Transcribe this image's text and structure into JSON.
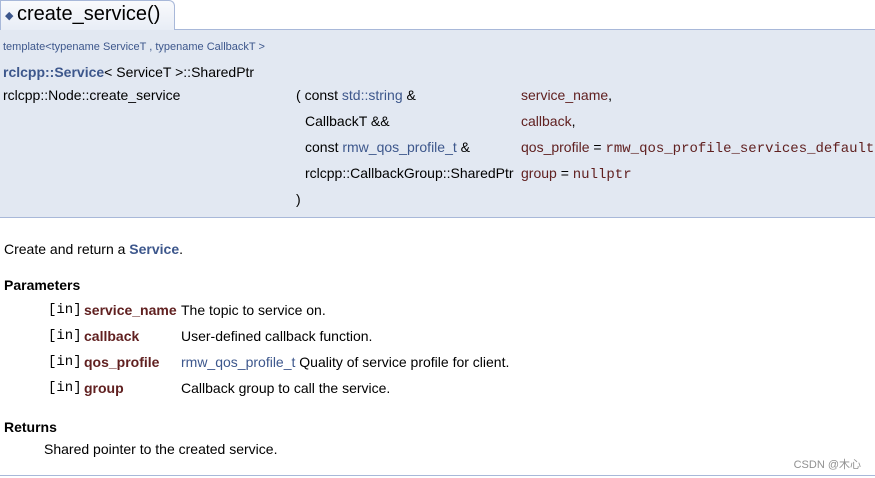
{
  "header": {
    "function_title": "create_service()"
  },
  "proto": {
    "template_line": "template<typename ServiceT , typename CallbackT >",
    "return_link": "rclcpp::Service",
    "return_rest": "< ServiceT >::SharedPtr",
    "function_name": "rclcpp::Node::create_service",
    "open_paren": "(",
    "close_paren": ")",
    "params": [
      {
        "prefix": "const ",
        "type_link": "std::string",
        "suffix": " &",
        "name": "service_name",
        "tail": ",",
        "default": ""
      },
      {
        "prefix": "CallbackT &&",
        "type_link": "",
        "suffix": "",
        "name": "callback",
        "tail": ",",
        "default": ""
      },
      {
        "prefix": "const ",
        "type_link": "rmw_qos_profile_t",
        "suffix": " &",
        "name": "qos_profile",
        "tail": " = ",
        "default": "rmw_qos_profile_services_default"
      },
      {
        "prefix": "rclcpp::CallbackGroup::SharedPtr",
        "type_link": "",
        "suffix": "",
        "name": "group",
        "tail": " = ",
        "default": "nullptr"
      }
    ]
  },
  "doc": {
    "description_prefix": "Create and return a ",
    "description_link": "Service",
    "description_suffix": ".",
    "parameters_heading": "Parameters",
    "parameters": [
      {
        "dir": "[in]",
        "name": "service_name",
        "desc_link": "",
        "desc": "The topic to service on."
      },
      {
        "dir": "[in]",
        "name": "callback",
        "desc_link": "",
        "desc": "User-defined callback function."
      },
      {
        "dir": "[in]",
        "name": "qos_profile",
        "desc_link": "rmw_qos_profile_t",
        "desc": " Quality of service profile for client."
      },
      {
        "dir": "[in]",
        "name": "group",
        "desc_link": "",
        "desc": "Callback group to call the service."
      }
    ],
    "returns_heading": "Returns",
    "returns_text": "Shared pointer to the created service."
  },
  "watermark": "CSDN @木心",
  "colors": {
    "link": "#3d578c",
    "param_name": "#602020",
    "proto_bg": "#e2e8f2",
    "border": "#a8b8d9"
  }
}
